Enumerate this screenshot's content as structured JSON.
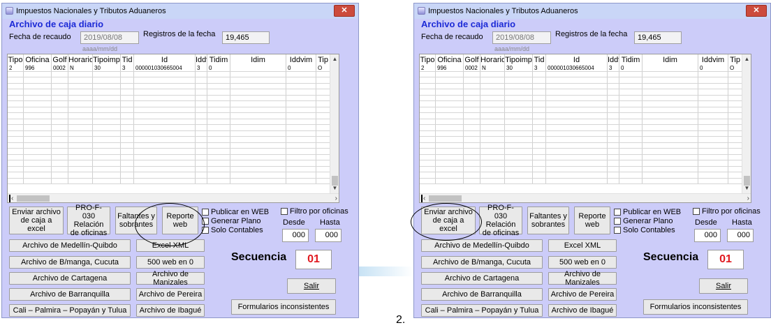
{
  "caption": "2.",
  "window": {
    "title": "Impuestos Nacionales y Tributos Aduaneros",
    "close_label": "✕",
    "heading": "Archivo de caja diario",
    "fecha_label": "Fecha de recaudo",
    "fecha_value": "2019/08/08",
    "fecha_hint": "aaaa/mm/dd",
    "registros_label": "Registros de la fecha",
    "registros_value": "19,465"
  },
  "grid": {
    "columns": [
      "Tipo",
      "Oficina",
      "Golf",
      "Horario",
      "Tipoimp",
      "Tid",
      "Id",
      "Iddv",
      "Tidim",
      "Idim",
      "Iddvim",
      "Tip"
    ],
    "row": [
      "2",
      "996",
      "0002",
      "N",
      "30",
      "3",
      "000001030665004",
      "3",
      "0",
      "",
      "0",
      "O"
    ]
  },
  "buttons": {
    "enviar": "Enviar archivo de caja a excel",
    "pro_f030": "PRO-F-030 Relación de oficinas",
    "faltantes": "Faltantes y sobrantes",
    "reporte": "Reporte web",
    "salir": "Salir",
    "formularios": "Formularios inconsistentes",
    "archivos_left": [
      "Archivo de Medellín-Quibdo",
      "Archivo de B/manga, Cucuta",
      "Archivo de Cartagena",
      "Archivo de Barranquilla",
      "Cali – Palmira – Popayán y Tulua"
    ],
    "archivos_right": [
      "Excel XML",
      "500 web en 0",
      "Archivo de Manizales",
      "Archivo de Pereira",
      "Archivo de Ibagué"
    ]
  },
  "options": {
    "publicar": "Publicar en WEB",
    "generar": "Generar Plano",
    "solo": "Solo Contables",
    "filtro": "Filtro por oficinas",
    "desde_label": "Desde",
    "hasta_label": "Hasta",
    "desde_value": "000",
    "hasta_value": "000"
  },
  "secuencia": {
    "label": "Secuencia",
    "value": "01"
  }
}
